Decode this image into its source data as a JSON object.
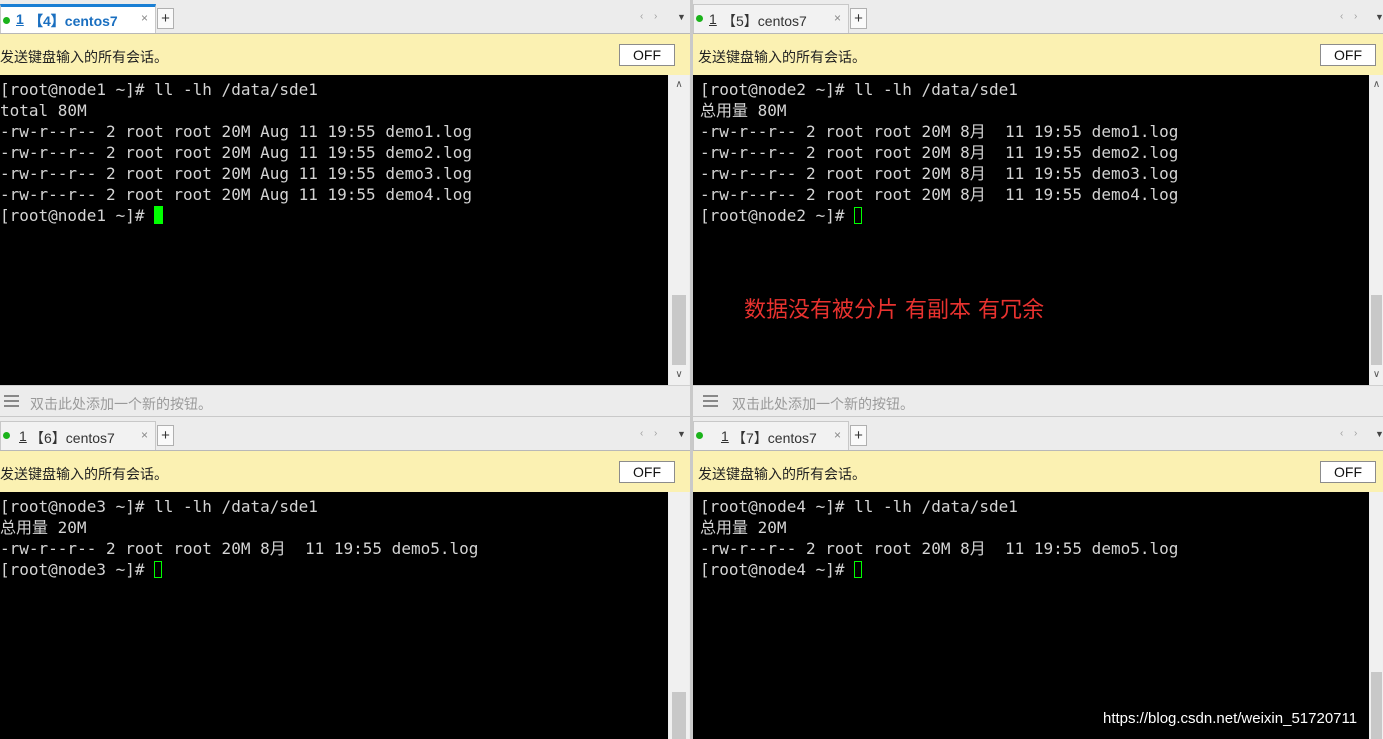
{
  "panes": [
    {
      "id": "p1",
      "tab": {
        "num": "1",
        "title": "【4】centos7",
        "close": "×",
        "active": true
      },
      "plus": "+",
      "broadcast": {
        "text": "发送键盘输入的所有会话。",
        "off_label": "OFF"
      },
      "terminal_lines": [
        "[root@node1 ~]# ll -lh /data/sde1",
        "total 80M",
        "-rw-r--r-- 2 root root 20M Aug 11 19:55 demo1.log",
        "-rw-r--r-- 2 root root 20M Aug 11 19:55 demo2.log",
        "-rw-r--r-- 2 root root 20M Aug 11 19:55 demo3.log",
        "-rw-r--r-- 2 root root 20M Aug 11 19:55 demo4.log"
      ],
      "prompt": "[root@node1 ~]# ",
      "button_bar_hint": "双击此处添加一个新的按钮。"
    },
    {
      "id": "p2",
      "tab": {
        "num": "1",
        "title": "【5】centos7",
        "close": "×",
        "active": false
      },
      "plus": "+",
      "broadcast": {
        "text": "发送键盘输入的所有会话。",
        "off_label": "OFF"
      },
      "terminal_lines": [
        "[root@node2 ~]# ll -lh /data/sde1",
        "总用量 80M",
        "-rw-r--r-- 2 root root 20M 8月  11 19:55 demo1.log",
        "-rw-r--r-- 2 root root 20M 8月  11 19:55 demo2.log",
        "-rw-r--r-- 2 root root 20M 8月  11 19:55 demo3.log",
        "-rw-r--r-- 2 root root 20M 8月  11 19:55 demo4.log"
      ],
      "prompt": "[root@node2 ~]# ",
      "button_bar_hint": "双击此处添加一个新的按钮。"
    },
    {
      "id": "p3",
      "tab": {
        "num": "1",
        "title": "【6】centos7",
        "close": "×",
        "active": false
      },
      "plus": "+",
      "broadcast": {
        "text": "发送键盘输入的所有会话。",
        "off_label": "OFF"
      },
      "terminal_lines": [
        "[root@node3 ~]# ll -lh /data/sde1",
        "总用量 20M",
        "-rw-r--r-- 2 root root 20M 8月  11 19:55 demo5.log"
      ],
      "prompt": "[root@node3 ~]# "
    },
    {
      "id": "p4",
      "tab": {
        "num": "1",
        "title": "【7】centos7",
        "close": "×",
        "active": false
      },
      "plus": "+",
      "broadcast": {
        "text": "发送键盘输入的所有会话。",
        "off_label": "OFF"
      },
      "terminal_lines": [
        "[root@node4 ~]# ll -lh /data/sde1",
        "总用量 20M",
        "-rw-r--r-- 2 root root 20M 8月  11 19:55 demo5.log"
      ],
      "prompt": "[root@node4 ~]# "
    }
  ],
  "annotation": "数据没有被分片 有副本 有冗余",
  "watermark": "https://blog.csdn.net/weixin_51720711",
  "icons": {
    "scroll_left": "‹",
    "scroll_right": "›",
    "tab_menu": "▼",
    "scroll_up": "∧",
    "scroll_down": "∨"
  },
  "colors": {
    "active_tab_accent": "#1a7fd4",
    "broadcast_bg": "#fbf1b2",
    "cursor": "#00ff00",
    "annotation": "#e8322f"
  }
}
